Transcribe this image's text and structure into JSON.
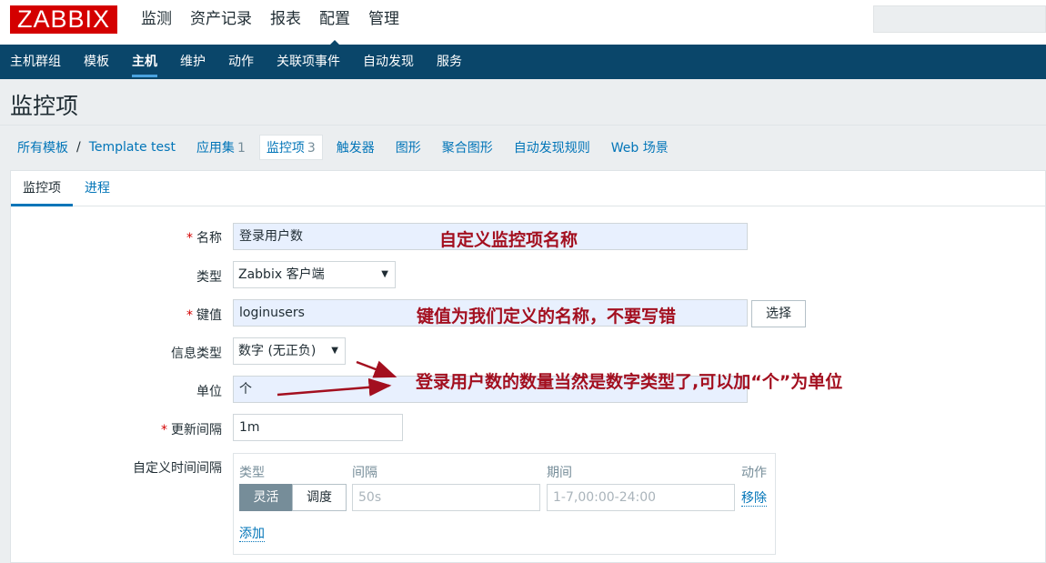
{
  "app": {
    "logo": "ZABBIX"
  },
  "top_nav": [
    "监测",
    "资产记录",
    "报表",
    "配置",
    "管理"
  ],
  "sub_nav": [
    "主机群组",
    "模板",
    "主机",
    "维护",
    "动作",
    "关联项事件",
    "自动发现",
    "服务"
  ],
  "page_title": "监控项",
  "breadcrumbs": {
    "all_templates": "所有模板",
    "separator": "/",
    "template": "Template test",
    "apps": "应用集",
    "apps_count": "1",
    "items": "监控项",
    "items_count": "3",
    "triggers": "触发器",
    "graphs": "图形",
    "screens": "聚合图形",
    "discovery": "自动发现规则",
    "web": "Web 场景"
  },
  "tabs": [
    "监控项",
    "进程"
  ],
  "form": {
    "name_label": "名称",
    "name_value": "登录用户数",
    "type_label": "类型",
    "type_value": "Zabbix 客户端",
    "key_label": "键值",
    "key_value": "loginusers",
    "select_button": "选择",
    "info_type_label": "信息类型",
    "info_type_value": "数字 (无正负)",
    "units_label": "单位",
    "units_value": "个",
    "interval_label": "更新间隔",
    "interval_value": "1m",
    "custom_label": "自定义时间间隔",
    "custom": {
      "col_type": "类型",
      "col_interval": "间隔",
      "col_period": "期间",
      "col_action": "动作",
      "flexible": "灵活",
      "scheduling": "调度",
      "interval_placeholder": "50s",
      "period_placeholder": "1-7,00:00-24:00",
      "remove": "移除",
      "add": "添加"
    }
  },
  "annotations": {
    "name_note": "自定义监控项名称",
    "key_note": "键值为我们定义的名称，不要写错",
    "unit_note": "登录用户数的数量当然是数字类型了,可以加“个”为单位",
    "color": "#a30f1f"
  }
}
